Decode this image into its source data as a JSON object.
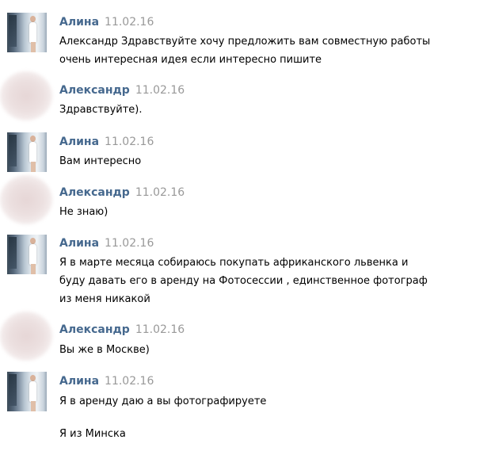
{
  "messages": [
    {
      "author": "Алина",
      "date": "11.02.16",
      "lines": [
        "Александр Здравствуйте хочу предложить вам совместную работы",
        "очень интересная идея если интересно пишите"
      ]
    },
    {
      "author": "Александр",
      "date": "11.02.16",
      "lines": [
        "Здравствуйте)."
      ]
    },
    {
      "author": "Алина",
      "date": "11.02.16",
      "lines": [
        "Вам интересно"
      ]
    },
    {
      "author": "Александр",
      "date": "11.02.16",
      "lines": [
        "Не знаю)"
      ]
    },
    {
      "author": "Алина",
      "date": "11.02.16",
      "lines": [
        "Я в марте месяца собираюсь покупать африканского львенка и",
        "буду давать его в аренду на Фотосессии , единственное фотограф",
        "из меня никакой"
      ]
    },
    {
      "author": "Александр",
      "date": "11.02.16",
      "lines": [
        "Вы же в Москве)"
      ]
    },
    {
      "author": "Алина",
      "date": "11.02.16",
      "lines": [
        "Я в аренду даю а вы фотографируете",
        "",
        "Я из Минска"
      ]
    }
  ]
}
